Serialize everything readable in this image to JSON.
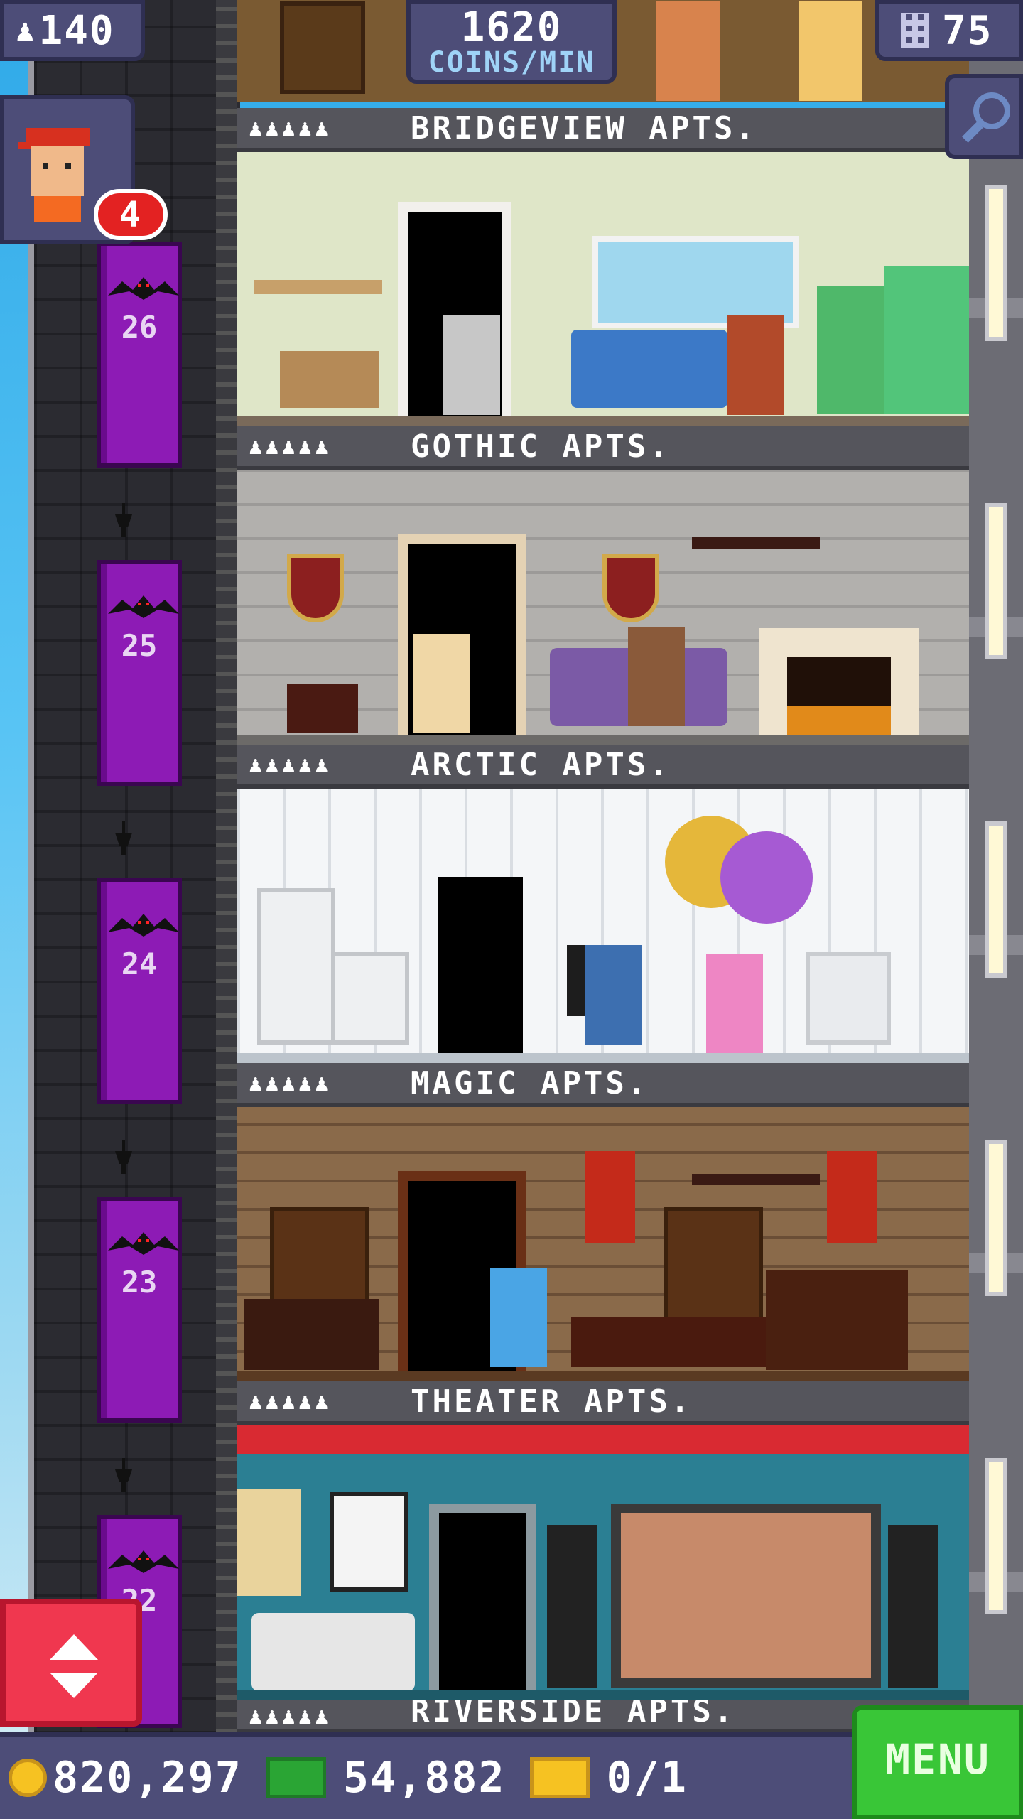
{
  "hud": {
    "population": "140",
    "coins_per_min_value": "1620",
    "coins_per_min_label": "COINS/MIN",
    "floors": "75",
    "visitor_badge": "4",
    "coins": "820,297",
    "bux": "54,882",
    "tickets": "0/1",
    "menu_label": "MENU"
  },
  "floors": [
    {
      "name": "BRIDGEVIEW APTS.",
      "stars": "♟♟♟♟♟",
      "theme": "bridgeview"
    },
    {
      "name": "GOTHIC APTS.",
      "stars": "♟♟♟♟♟",
      "theme": "gothic"
    },
    {
      "name": "ARCTIC APTS.",
      "stars": "♟♟♟♟♟",
      "theme": "arctic"
    },
    {
      "name": "MAGIC APTS.",
      "stars": "♟♟♟♟♟",
      "theme": "magic"
    },
    {
      "name": "THEATER APTS.",
      "stars": "♟♟♟♟♟",
      "theme": "theater"
    },
    {
      "name": "RIVERSIDE APTS.",
      "stars": "♟♟♟♟♟",
      "theme": "riverside"
    }
  ],
  "elevator_floors": [
    "26",
    "25",
    "24",
    "23",
    "22"
  ],
  "colors": {
    "hud_bg": "#4d4d78",
    "elevator_purple": "#8d1bb5",
    "menu_green": "#39c637",
    "elevator_button_red": "#f0374f",
    "badge_red": "#e32222"
  },
  "icons": {
    "population": "person-icon",
    "floors": "building-icon",
    "find": "magnifier-icon",
    "coins": "coin-icon",
    "bux": "bux-icon",
    "tickets": "ticket-icon",
    "elevator": "up-down-arrows-icon"
  }
}
